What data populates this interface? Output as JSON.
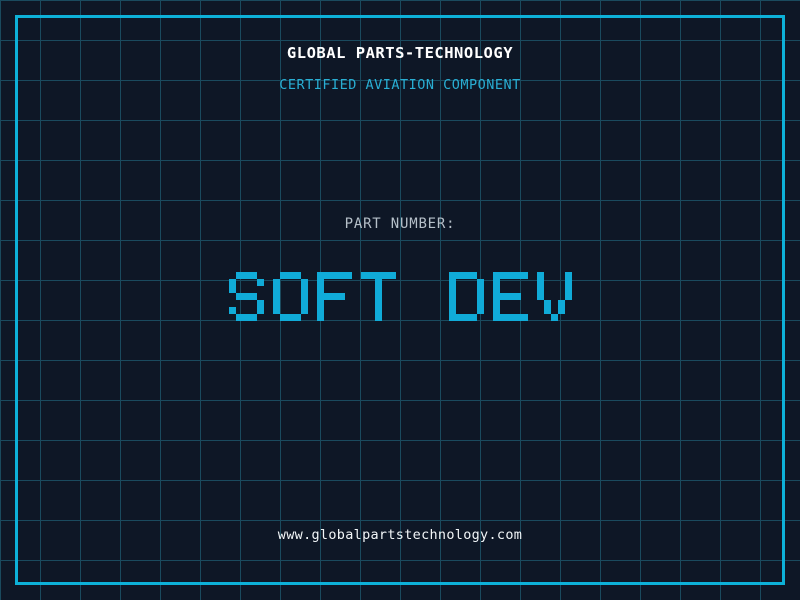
{
  "page": {
    "background_color": "#0e1726",
    "grid_color": "#1a4a5e",
    "frame_color": "#0db1d8"
  },
  "header": {
    "company_name": "GLOBAL PARTS-TECHNOLOGY",
    "tagline": "CERTIFIED AVIATION COMPONENT",
    "tagline_color": "#29aed3"
  },
  "part": {
    "label": "PART NUMBER:",
    "value": "SOFT DEV",
    "value_color": "#10abd8"
  },
  "footer": {
    "website": "www.globalpartstechnology.com"
  }
}
